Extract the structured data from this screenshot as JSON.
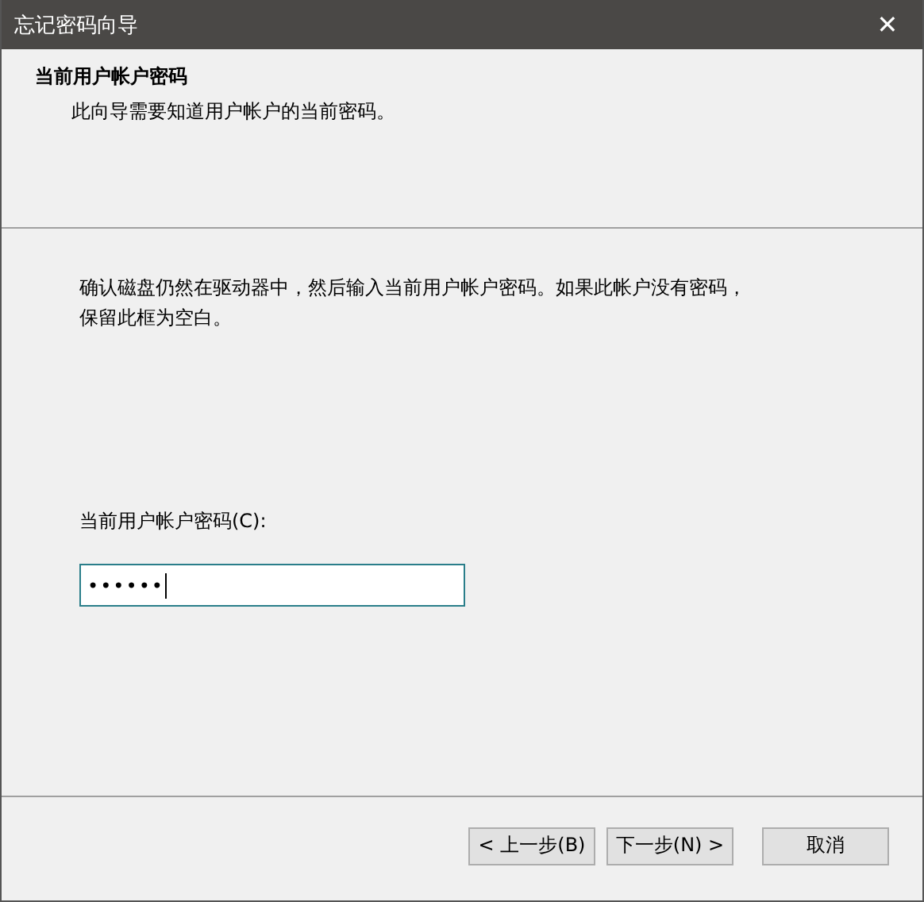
{
  "window": {
    "title": "忘记密码向导",
    "close": "✕"
  },
  "header": {
    "title": "当前用户帐户密码",
    "subtitle": "此向导需要知道用户帐户的当前密码。"
  },
  "body": {
    "instructions": "确认磁盘仍然在驱动器中，然后输入当前用户帐户密码。如果此帐户没有密码，保留此框为空白。",
    "password": {
      "label": "当前用户帐户密码(C):",
      "value": "••••••",
      "focused": true
    }
  },
  "buttons": [
    {
      "label": "< 上一步(B)",
      "kind": "back"
    },
    {
      "label": "下一步(N) >",
      "kind": "next"
    },
    {
      "label": "取消",
      "kind": "cancel"
    }
  ]
}
